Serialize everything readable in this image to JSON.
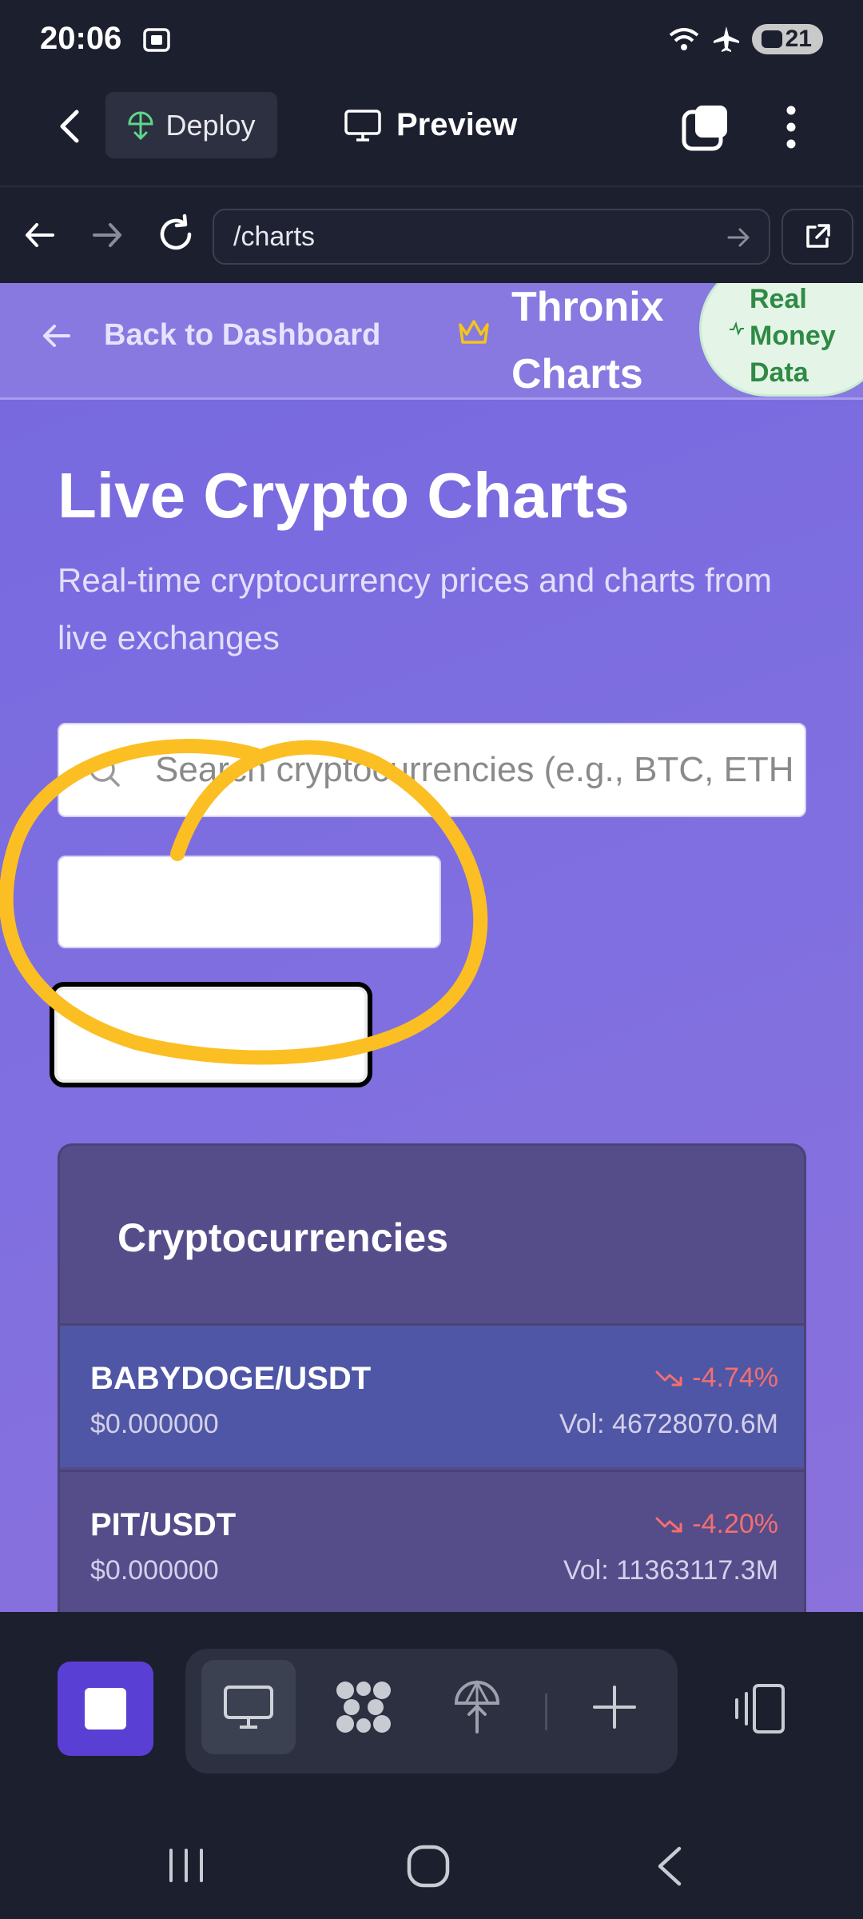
{
  "status_bar": {
    "time": "20:06",
    "battery": "21"
  },
  "app_header": {
    "deploy_label": "Deploy",
    "preview_label": "Preview"
  },
  "url_bar": {
    "url": "/charts"
  },
  "site_nav": {
    "back_label": "Back to Dashboard",
    "brand": "Thronix Charts",
    "badge": "Real Money Data"
  },
  "hero": {
    "title": "Live Crypto Charts",
    "subtitle": "Real-time cryptocurrency prices and charts from live exchanges"
  },
  "search": {
    "placeholder": "Search cryptocurrencies (e.g., BTC, ETH)"
  },
  "crypto_list": {
    "title": "Cryptocurrencies",
    "rows": [
      {
        "pair": "BABYDOGE/USDT",
        "price": "$0.000000",
        "change": "-4.74%",
        "volume": "Vol: 46728070.6M"
      },
      {
        "pair": "PIT/USDT",
        "price": "$0.000000",
        "change": "-4.20%",
        "volume": "Vol: 11363117.3M"
      }
    ]
  },
  "colors": {
    "accent": "#5a3fd4",
    "page_gradient_start": "#7668df",
    "negative": "#f36f6f",
    "badge_green": "#2f8a45",
    "annotation": "#fbbf24"
  },
  "icons": [
    "screenshot-icon",
    "wifi-icon",
    "airplane-icon",
    "back-arrow-icon",
    "deploy-icon",
    "monitor-icon",
    "tabs-icon",
    "more-vert-icon",
    "arrow-left-icon",
    "arrow-right-icon",
    "reload-icon",
    "go-arrow-icon",
    "external-link-icon",
    "crown-icon",
    "pulse-icon",
    "search-icon",
    "trending-down-icon",
    "stop-icon",
    "monitor-icon",
    "apps-icon",
    "deploy-icon",
    "plus-icon",
    "device-toggle-icon"
  ]
}
